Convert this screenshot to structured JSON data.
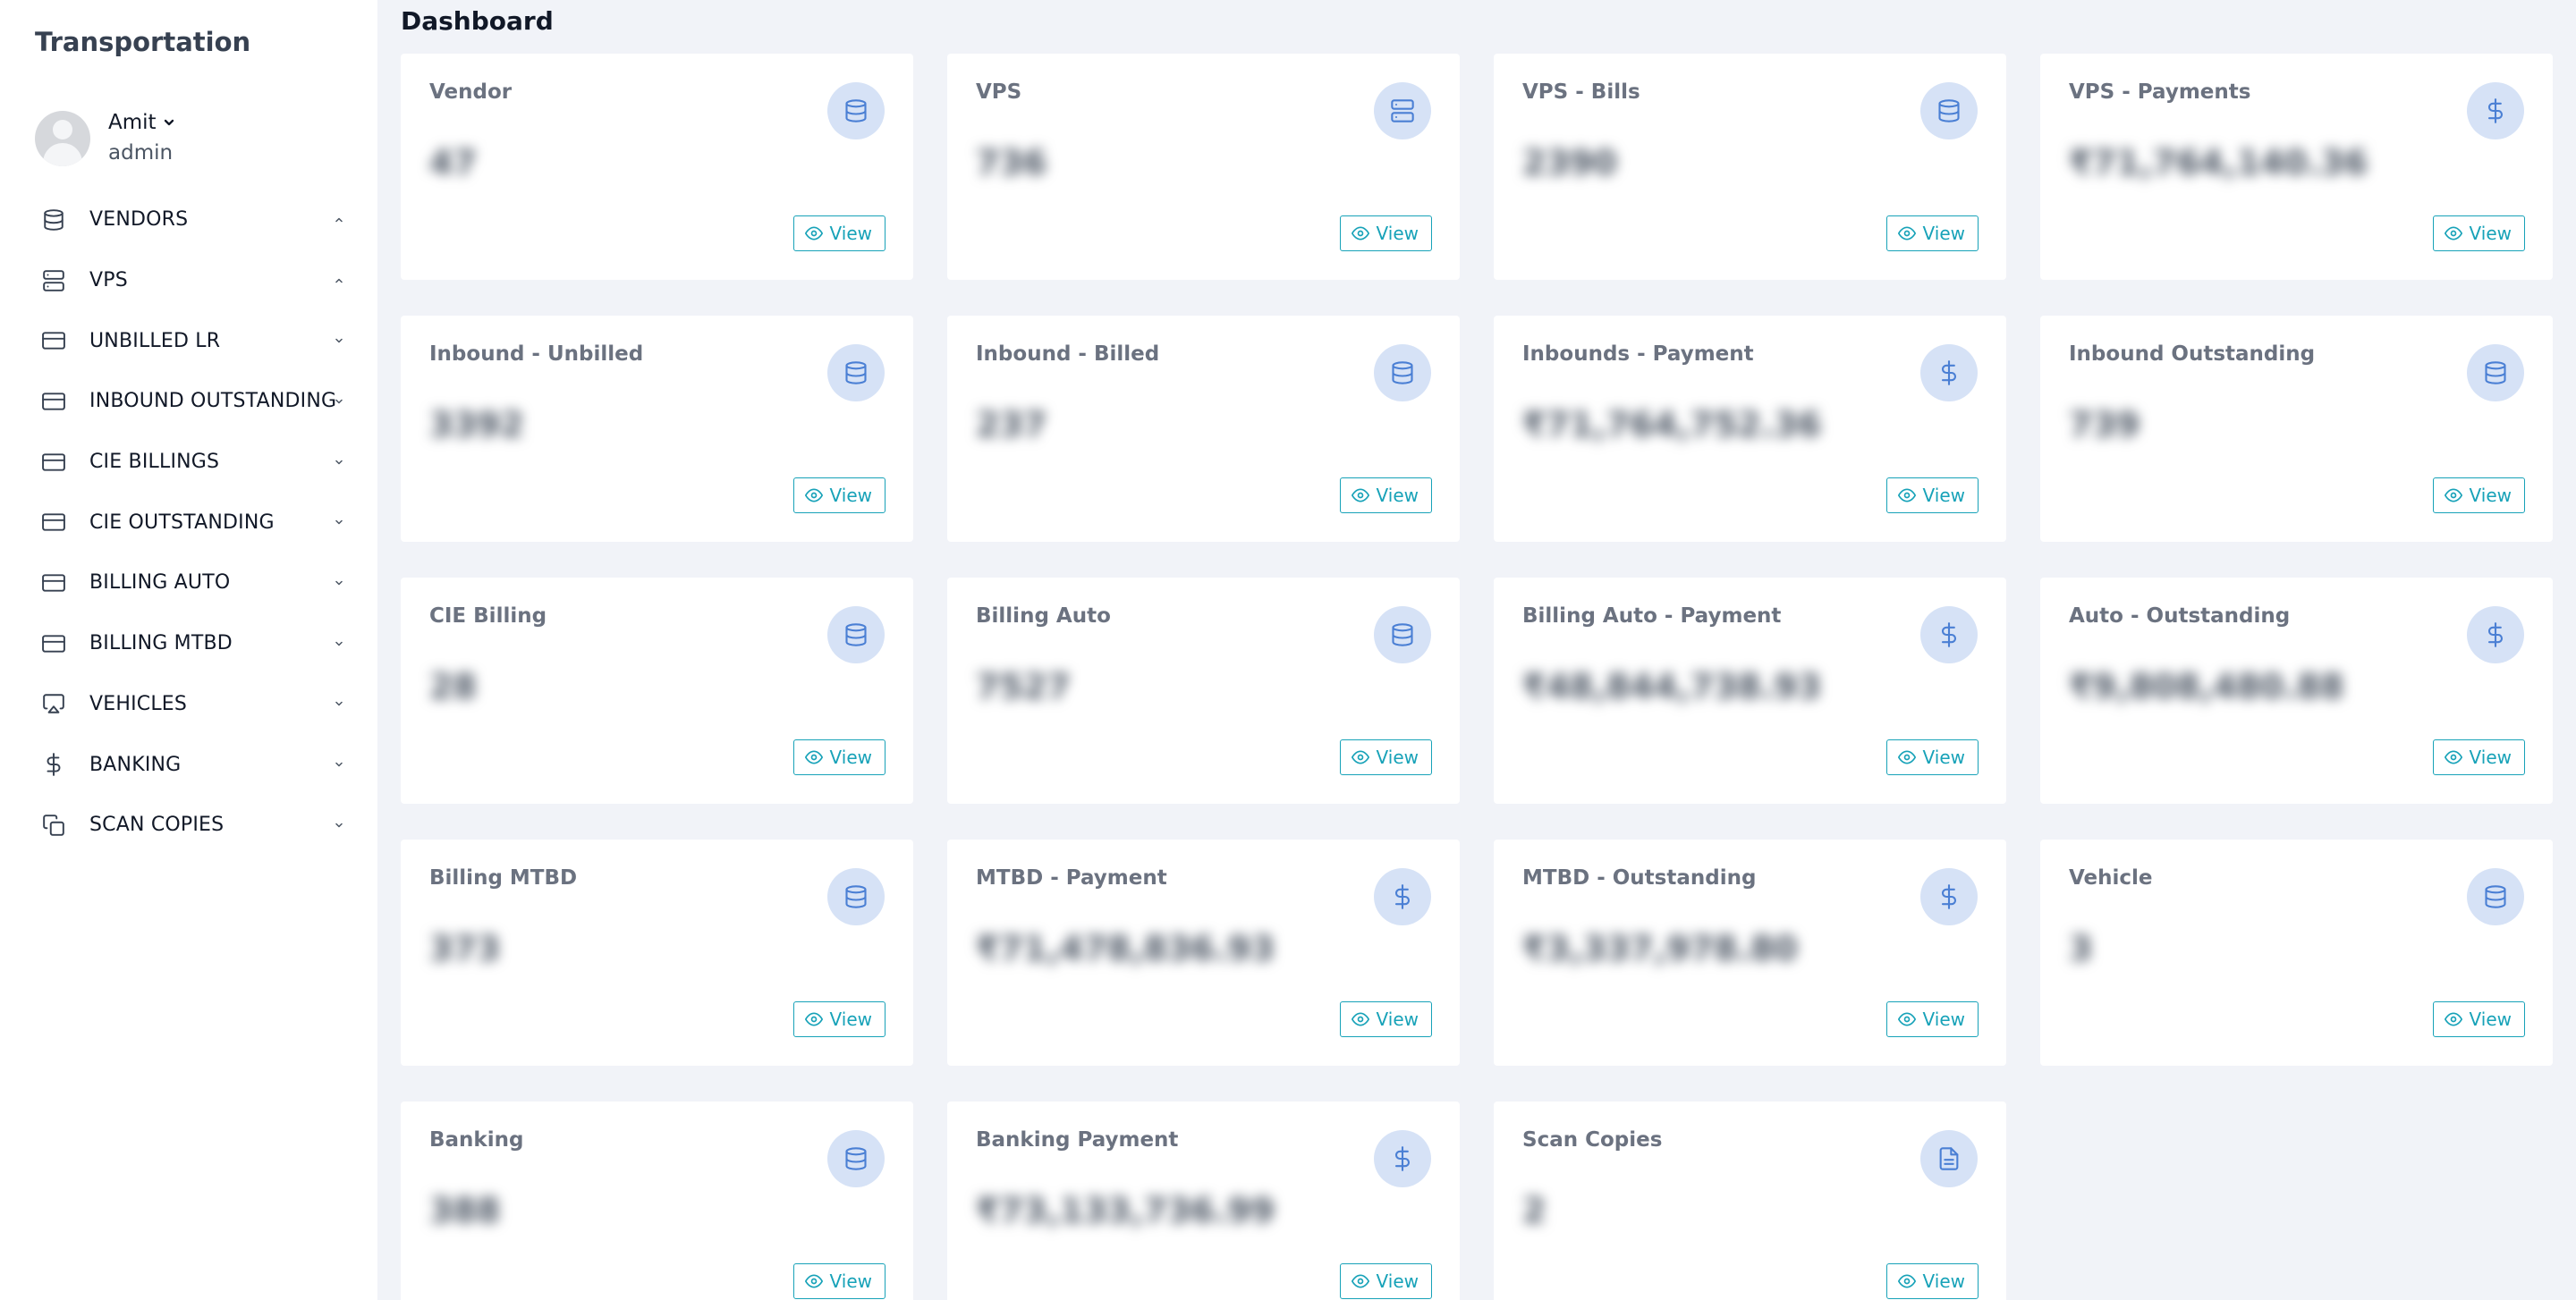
{
  "app": {
    "title": "Transportation"
  },
  "user": {
    "name": "Amit",
    "role": "admin"
  },
  "page": {
    "title": "Dashboard"
  },
  "nav": [
    {
      "label": "VENDORS",
      "icon": "database-icon",
      "chevron": "up"
    },
    {
      "label": "VPS",
      "icon": "server-icon",
      "chevron": "up"
    },
    {
      "label": "UNBILLED LR",
      "icon": "credit-card-icon",
      "chevron": "down"
    },
    {
      "label": "INBOUND OUTSTANDING",
      "icon": "credit-card-icon",
      "chevron": "down"
    },
    {
      "label": "CIE BILLINGS",
      "icon": "credit-card-icon",
      "chevron": "down"
    },
    {
      "label": "CIE OUTSTANDING",
      "icon": "credit-card-icon",
      "chevron": "down"
    },
    {
      "label": "BILLING AUTO",
      "icon": "credit-card-icon",
      "chevron": "down"
    },
    {
      "label": "BILLING MTBD",
      "icon": "credit-card-icon",
      "chevron": "down"
    },
    {
      "label": "VEHICLES",
      "icon": "airplay-icon",
      "chevron": "down"
    },
    {
      "label": "BANKING",
      "icon": "dollar-icon",
      "chevron": "down"
    },
    {
      "label": "SCAN COPIES",
      "icon": "copy-icon",
      "chevron": "down"
    }
  ],
  "view_label": "View",
  "cards": [
    {
      "title": "Vendor",
      "icon": "database-icon",
      "value": "47"
    },
    {
      "title": "VPS",
      "icon": "server-icon",
      "value": "736"
    },
    {
      "title": "VPS - Bills",
      "icon": "database-icon",
      "value": "2390"
    },
    {
      "title": "VPS - Payments",
      "icon": "dollar-icon",
      "value": "₹71,764,140.36"
    },
    {
      "title": "Inbound - Unbilled",
      "icon": "database-icon",
      "value": "3392"
    },
    {
      "title": "Inbound - Billed",
      "icon": "database-icon",
      "value": "237"
    },
    {
      "title": "Inbounds - Payment",
      "icon": "dollar-icon",
      "value": "₹71,764,752.36"
    },
    {
      "title": "Inbound Outstanding",
      "icon": "database-icon",
      "value": "739"
    },
    {
      "title": "CIE Billing",
      "icon": "database-icon",
      "value": "28"
    },
    {
      "title": "Billing Auto",
      "icon": "database-icon",
      "value": "7527"
    },
    {
      "title": "Billing Auto - Payment",
      "icon": "dollar-icon",
      "value": "₹48,844,738.93"
    },
    {
      "title": "Auto - Outstanding",
      "icon": "dollar-icon",
      "value": "₹9,808,480.88"
    },
    {
      "title": "Billing MTBD",
      "icon": "database-icon",
      "value": "373"
    },
    {
      "title": "MTBD - Payment",
      "icon": "dollar-icon",
      "value": "₹71,478,836.93"
    },
    {
      "title": "MTBD - Outstanding",
      "icon": "dollar-icon",
      "value": "₹3,337,978.80"
    },
    {
      "title": "Vehicle",
      "icon": "database-icon",
      "value": "3"
    },
    {
      "title": "Banking",
      "icon": "database-icon",
      "value": "388"
    },
    {
      "title": "Banking Payment",
      "icon": "dollar-icon",
      "value": "₹73,133,736.99"
    },
    {
      "title": "Scan Copies",
      "icon": "file-text-icon",
      "value": "2"
    }
  ],
  "colors": {
    "accent": "#17a2b8",
    "icon_bg": "#d6e2f6",
    "icon_fg": "#4a7fd4",
    "page_bg": "#f1f3f8"
  }
}
